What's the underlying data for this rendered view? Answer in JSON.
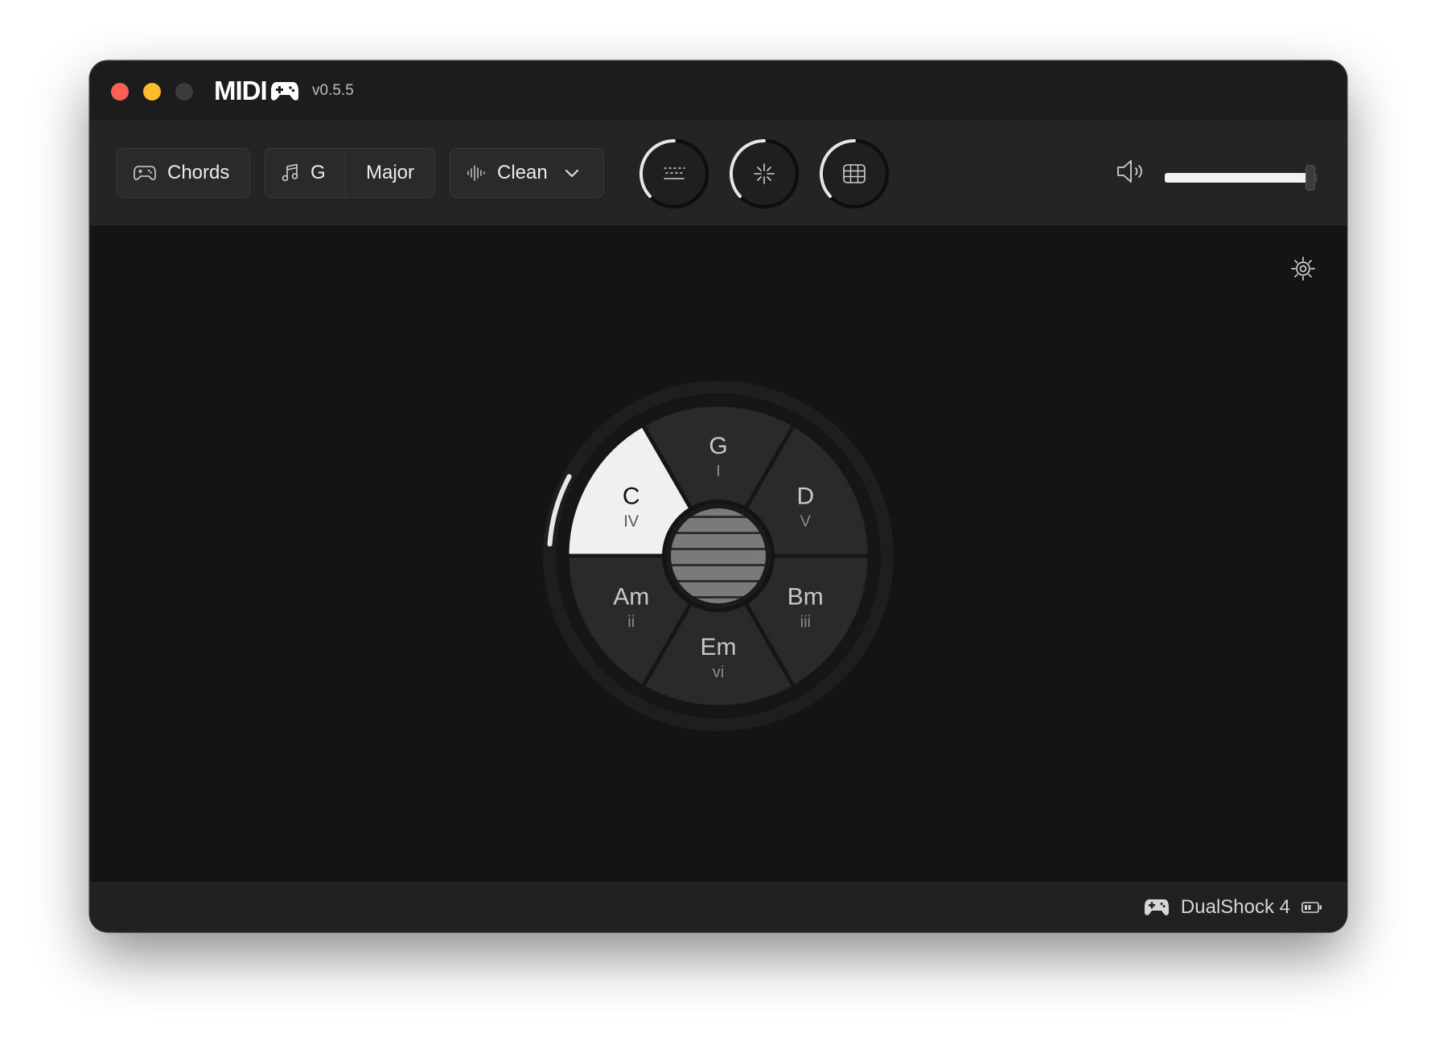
{
  "app": {
    "logo_text": "MIDI",
    "version": "v0.5.5"
  },
  "toolbar": {
    "mode_label": "Chords",
    "key_root": "G",
    "key_scale": "Major",
    "sound_label": "Clean",
    "dial_icons": [
      "keyboard-icon",
      "sparkle-icon",
      "grid-icon"
    ],
    "volume_level": 0.95
  },
  "wheel": {
    "segments": [
      {
        "chord": "G",
        "numeral": "I",
        "active": false
      },
      {
        "chord": "D",
        "numeral": "V",
        "active": false
      },
      {
        "chord": "Bm",
        "numeral": "iii",
        "active": false
      },
      {
        "chord": "Em",
        "numeral": "vi",
        "active": false
      },
      {
        "chord": "Am",
        "numeral": "ii",
        "active": false
      },
      {
        "chord": "C",
        "numeral": "IV",
        "active": true
      }
    ],
    "colors": {
      "segment": "#2a2a2a",
      "active_segment": "#f0f0f0",
      "label": "#c8c8c8",
      "active_label": "#111111"
    }
  },
  "status": {
    "controller_name": "DualShock 4",
    "battery_icon": "battery-low-icon"
  }
}
